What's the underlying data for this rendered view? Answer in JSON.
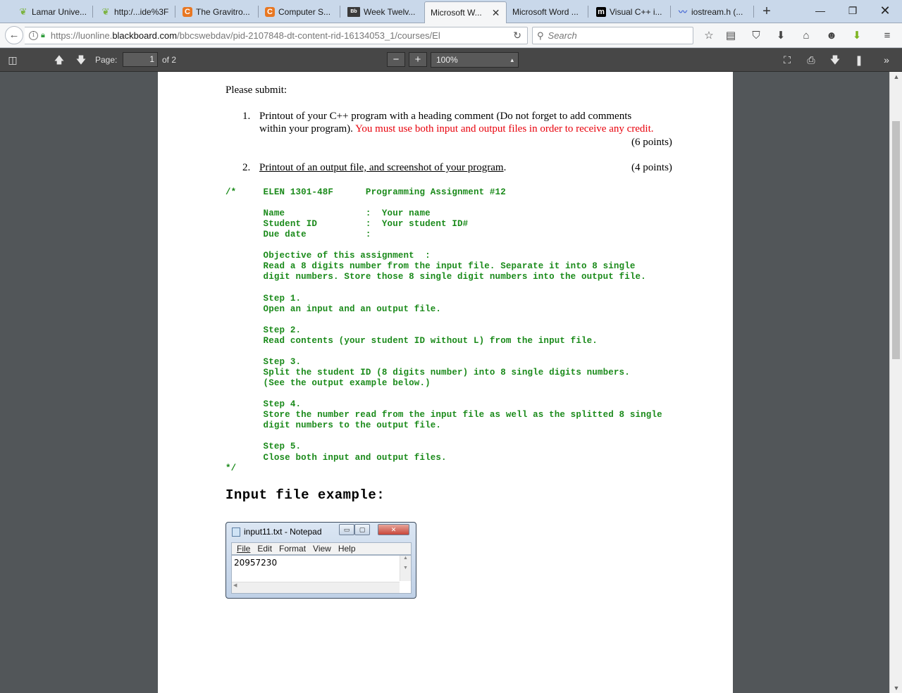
{
  "tabs": [
    {
      "label": "Lamar Unive...",
      "icon": "leaf-icon"
    },
    {
      "label": "http:/...ide%3F",
      "icon": "leaf-icon"
    },
    {
      "label": "The Gravitro...",
      "icon": "chegg-icon"
    },
    {
      "label": "Computer S...",
      "icon": "chegg-icon"
    },
    {
      "label": "Week Twelv...",
      "icon": "blackboard-icon"
    },
    {
      "label": "Microsoft W...",
      "icon": "none",
      "active": true
    },
    {
      "label": "Microsoft Word ...",
      "icon": "none"
    },
    {
      "label": "Visual C++ i...",
      "icon": "m-icon"
    },
    {
      "label": "iostream.h (...",
      "icon": "wave-icon"
    }
  ],
  "nav": {
    "url_prefix": "https://luonline.",
    "url_domain": "blackboard.com",
    "url_rest": "/bbcswebdav/pid-2107848-dt-content-rid-16134053_1/courses/El",
    "search_placeholder": "Search"
  },
  "pdf_toolbar": {
    "page_label": "Page:",
    "page_value": "1",
    "page_of": "of 2",
    "zoom": "100%"
  },
  "document": {
    "please_submit": "Please submit:",
    "item1_num": "1.",
    "item1_line1": "Printout of your C++ program with a heading comment (Do not forget to add comments",
    "item1_line2_black": "within your program).",
    "item1_line2_red": "You must use both input and output files in order to receive any credit.",
    "item1_points": "(6 points)",
    "item2_num": "2.",
    "item2_text": "Printout of an output file, and screenshot of your program",
    "item2_period": ".",
    "item2_points": "(4 points)",
    "code_lines": [
      "/*     ELEN 1301-48F      Programming Assignment #12",
      "",
      "       Name               :  Your name",
      "       Student ID         :  Your student ID#",
      "       Due date           :",
      "",
      "       Objective of this assignment  :",
      "       Read a 8 digits number from the input file. Separate it into 8 single",
      "       digit numbers. Store those 8 single digit numbers into the output file.",
      "",
      "       Step 1.",
      "       Open an input and an output file.",
      "",
      "       Step 2.",
      "       Read contents (your student ID without L) from the input file.",
      "",
      "       Step 3.",
      "       Split the student ID (8 digits number) into 8 single digits numbers.",
      "       (See the output example below.)",
      "",
      "       Step 4.",
      "       Store the number read from the input file as well as the splitted 8 single",
      "       digit numbers to the output file.",
      "",
      "       Step 5.",
      "       Close both input and output files.",
      "*/"
    ],
    "input_header": "Input file example:",
    "notepad": {
      "title": "input11.txt - Notepad",
      "menu": [
        "File",
        "Edit",
        "Format",
        "View",
        "Help"
      ],
      "content": "20957230"
    }
  }
}
